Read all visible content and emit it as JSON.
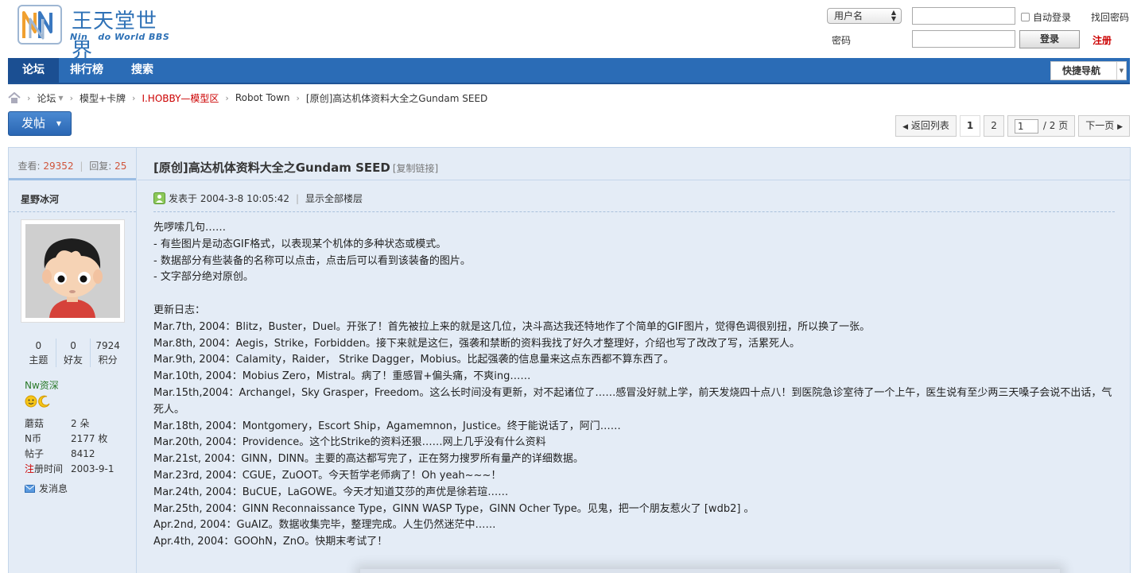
{
  "header": {
    "logo_title": "王天堂世界",
    "logo_subtitle": "Nin   do World BBS",
    "login": {
      "username_select": "用户名",
      "password_label": "密码",
      "auto_login": "自动登录",
      "forgot_password": "找回密码",
      "login_button": "登录",
      "register": "注册"
    }
  },
  "nav": {
    "items": [
      "论坛",
      "排行榜",
      "搜索"
    ],
    "quick_nav": "快捷导航"
  },
  "breadcrumb": [
    "论坛",
    "模型+卡牌",
    "I.HOBBY—模型区",
    "Robot Town",
    "[原创]高达机体资料大全之Gundam SEED"
  ],
  "actions": {
    "post_button": "发帖",
    "back_to_list": "返回列表",
    "pages": [
      "1",
      "2"
    ],
    "page_input": "1",
    "page_total": "/ 2 页",
    "next_page": "下一页"
  },
  "thread": {
    "views_label": "查看:",
    "views": "29352",
    "replies_label": "回复:",
    "replies": "25",
    "title": "[原创]高达机体资料大全之Gundam SEED",
    "copy_link": "[复制链接]",
    "posted_at": "发表于 2004-3-8 10:05:42",
    "show_all": "显示全部楼层"
  },
  "author": {
    "name": "星野冰河",
    "stats": [
      {
        "value": "0",
        "label": "主题"
      },
      {
        "value": "0",
        "label": "好友"
      },
      {
        "value": "7924",
        "label": "积分"
      }
    ],
    "group": "Nw资深",
    "info": [
      {
        "key": "蘑菇",
        "value": "2 朵"
      },
      {
        "key": "N币",
        "value": "2177 枚"
      },
      {
        "key": "帖子",
        "value": "8412"
      },
      {
        "key_red": "注",
        "key": "册时间",
        "value": "2003-9-1"
      }
    ],
    "send_message": "发消息"
  },
  "post": {
    "lines": [
      "先啰嗦几句……",
      "- 有些图片是动态GIF格式，以表现某个机体的多种状态或模式。",
      "- 数据部分有些装备的名称可以点击，点击后可以看到该装备的图片。",
      "- 文字部分绝对原创。",
      "",
      "更新日志：",
      "Mar.7th, 2004：Blitz，Buster，Duel。开张了！首先被拉上来的就是这几位，决斗高达我还特地作了个简单的GIF图片，觉得色调很别扭，所以换了一张。",
      "Mar.8th, 2004：Aegis，Strike，Forbidden。接下来就是这仨，强袭和禁断的资料我找了好久才整理好，介绍也写了改改了写，活累死人。",
      "Mar.9th, 2004：Calamity，Raider， Strike Dagger，Mobius。比起强袭的信息量来这点东西都不算东西了。",
      "Mar.10th, 2004：Mobius Zero，Mistral。病了！重感冒+偏头痛，不爽ing……",
      "Mar.15th,2004：Archangel，Sky Grasper，Freedom。这么长时间没有更新，对不起诸位了……感冒没好就上学，前天发烧四十点八！到医院急诊室待了一个上午，医生说有至少两三天嗓子会说不出话，气死人。",
      "Mar.18th, 2004：Montgomery，Escort Ship，Agamemnon，Justice。终于能说话了，阿门……",
      "Mar.20th, 2004：Providence。这个比Strike的资料还狠……网上几乎没有什么资料",
      "Mar.21st, 2004：GINN，DINN。主要的高达都写完了，正在努力搜罗所有量产的详细数据。",
      "Mar.23rd, 2004：CGUE，ZuOOT。今天哲学老师病了！Oh yeah~~~！",
      "Mar.24th, 2004：BuCUE，LaGOWE。今天才知道艾莎的声优是徐若瑄……",
      "Mar.25th, 2004：GINN Reconnaissance Type，GINN WASP Type，GINN Ocher Type。见鬼，把一个朋友惹火了 [wdb2] 。",
      "Apr.2nd, 2004：GuAIZ。数据收集完毕，整理完成。人生仍然迷茫中……",
      "Apr.4th, 2004：GOOhN，ZnO。快期末考试了！"
    ]
  },
  "colors": {
    "nav_blue": "#2b6cb6",
    "nav_active": "#1b4f92",
    "thread_bg": "#e4ecf6",
    "accent_red": "#cc0000",
    "stat_orange": "#d0543a"
  }
}
